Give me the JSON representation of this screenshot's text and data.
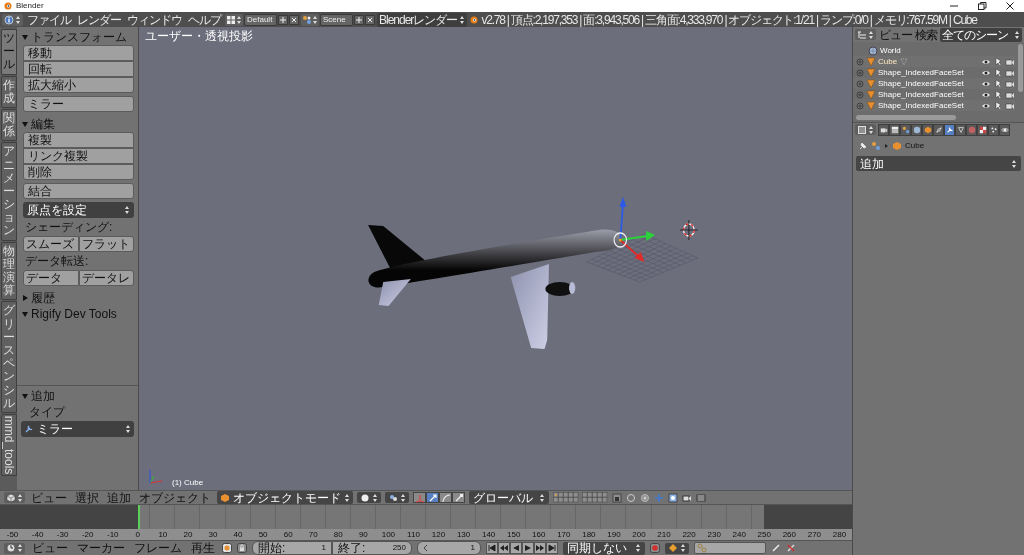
{
  "window": {
    "title": "Blender"
  },
  "info_header": {
    "menus": [
      "ファイル",
      "レンダー",
      "ウィンドウ",
      "ヘルプ"
    ],
    "screen_layout": "Default",
    "scene": "Scene",
    "render_engine": "Blenderレンダー",
    "stats": "v2.78 | 頂点:2,197,353 | 面:3,943,506 | 三角面:4,333,970 | オブジェクト:1/21 | ランプ:0/0 | メモリ:767.59M | Cube"
  },
  "tool_tabs": [
    {
      "kind": "stacked",
      "label": "ツール",
      "selected": true
    },
    {
      "kind": "stacked",
      "label": "作成",
      "selected": false
    },
    {
      "kind": "stacked",
      "label": "関係",
      "selected": false
    },
    {
      "kind": "stacked",
      "label": "アニメーション",
      "selected": false
    },
    {
      "kind": "stacked",
      "label": "物理演算",
      "selected": false
    },
    {
      "kind": "stacked",
      "label": "グリースペンシル",
      "selected": false
    },
    {
      "kind": "rotated",
      "label": "mmd_tools",
      "selected": false
    }
  ],
  "tool_panels": [
    {
      "title": "トランスフォーム",
      "expanded": true,
      "items": [
        {
          "kind": "group",
          "buttons": [
            "移動",
            "回転",
            "拡大縮小"
          ]
        },
        {
          "kind": "button",
          "label": "ミラー"
        }
      ]
    },
    {
      "title": "編集",
      "expanded": true,
      "items": [
        {
          "kind": "group",
          "buttons": [
            "複製",
            "リンク複製",
            "削除"
          ]
        },
        {
          "kind": "button",
          "label": "結合"
        },
        {
          "kind": "dropdown",
          "label": "原点を設定"
        },
        {
          "kind": "label",
          "label": "シェーディング:"
        },
        {
          "kind": "row",
          "buttons": [
            "スムーズ",
            "フラット"
          ]
        },
        {
          "kind": "label",
          "label": "データ転送:"
        },
        {
          "kind": "row",
          "buttons": [
            "データ",
            "データレ"
          ]
        }
      ]
    },
    {
      "title": "履歴",
      "expanded": false
    },
    {
      "title": "Rigify Dev Tools",
      "expanded": true
    }
  ],
  "operator_panel": {
    "title": "追加",
    "expanded": true,
    "label": "タイプ",
    "value": "ミラー"
  },
  "viewport": {
    "view_name": "ユーザー・透視投影",
    "object_info": "(1) Cube"
  },
  "outliner": {
    "menus": [
      "ビュー",
      "検索"
    ],
    "scope": "全てのシーン",
    "rows": [
      {
        "kind": "world",
        "name": "World"
      },
      {
        "kind": "active_object",
        "name": "Cube"
      },
      {
        "kind": "object",
        "name": "Shape_IndexedFaceSet"
      },
      {
        "kind": "object",
        "name": "Shape_IndexedFaceSet"
      },
      {
        "kind": "object",
        "name": "Shape_IndexedFaceSet"
      },
      {
        "kind": "object",
        "name": "Shape_IndexedFaceSet"
      }
    ]
  },
  "properties": {
    "tabs": [
      {
        "selected": false
      },
      {
        "selected": false
      },
      {
        "selected": false
      },
      {
        "selected": false
      },
      {
        "selected": false
      },
      {
        "selected": false
      },
      {
        "selected": true
      },
      {
        "selected": false
      },
      {
        "selected": false
      },
      {
        "selected": false
      },
      {
        "selected": false
      },
      {
        "selected": false
      }
    ],
    "object_name": "Cube",
    "add_modifier": "追加"
  },
  "view3d_header": {
    "menus": [
      "ビュー",
      "選択",
      "追加",
      "オブジェクト"
    ],
    "mode": "オブジェクトモード",
    "manipulators": [
      {
        "selected": false
      },
      {
        "selected": true
      },
      {
        "selected": false
      },
      {
        "selected": false
      }
    ],
    "orientation": "グローバル"
  },
  "timeline": {
    "ruler": [
      "-50",
      "-40",
      "-30",
      "-20",
      "-10",
      "0",
      "10",
      "20",
      "30",
      "40",
      "50",
      "60",
      "70",
      "80",
      "90",
      "100",
      "110",
      "120",
      "130",
      "140",
      "150",
      "160",
      "170",
      "180",
      "190",
      "200",
      "210",
      "220",
      "230",
      "240",
      "250",
      "260",
      "270",
      "280"
    ],
    "menus": [
      "ビュー",
      "マーカー",
      "フレーム",
      "再生"
    ],
    "start_label": "開始:",
    "start": "1",
    "end_label": "終了:",
    "end": "250",
    "current": "1",
    "sync": "同期しない"
  }
}
